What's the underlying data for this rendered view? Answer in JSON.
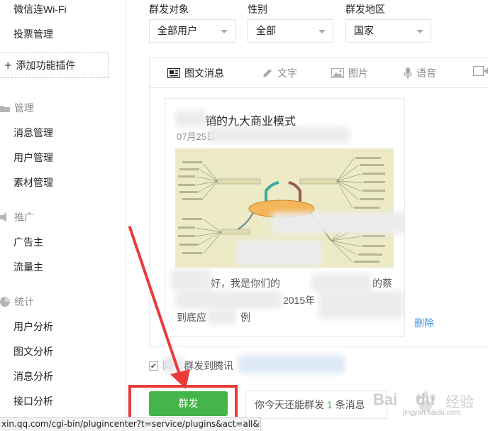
{
  "sidebar": {
    "items_top": [
      {
        "label": "微信连Wi-Fi"
      },
      {
        "label": "投票管理"
      }
    ],
    "add_plugin_label": "添加功能插件",
    "sections": [
      {
        "title": "管理",
        "items": [
          "消息管理",
          "用户管理",
          "素材管理"
        ]
      },
      {
        "title": "推广",
        "items": [
          "广告主",
          "流量主"
        ]
      },
      {
        "title": "统计",
        "items": [
          "用户分析",
          "图文分析",
          "消息分析",
          "接口分析"
        ]
      }
    ]
  },
  "filters": {
    "target": {
      "label": "群发对象",
      "value": "全部用户"
    },
    "gender": {
      "label": "性别",
      "value": "全部"
    },
    "region": {
      "label": "群发地区",
      "value": "国家"
    }
  },
  "tabs": [
    "图文消息",
    "文字",
    "图片",
    "语音"
  ],
  "article": {
    "title": "销的九大商业模式",
    "date": "07月25日",
    "excerpt_line1": "好，我是你们的",
    "excerpt_line1b": "的蔡",
    "excerpt_line2": "2015年",
    "excerpt_line3": "到底应",
    "excerpt_line3b": "例"
  },
  "delete_label": "删除",
  "sync": {
    "prefix": "同",
    "label": "群发到腾讯",
    "suffix": "",
    "checked_glyph": "✔"
  },
  "send_button": "群发",
  "quota": {
    "prefix": "你今天还能群发",
    "count": "1",
    "suffix": "条消息"
  },
  "statusbar_url": "xin.qq.com/cgi-bin/plugincenter?t=service/plugins&act=all&t...",
  "watermark": {
    "brand": "Bai",
    "brand2": "du",
    "product": "经验",
    "domain": "jingyan.baidu.com"
  },
  "colors": {
    "accent_green": "#44b549",
    "link_blue": "#459ae9",
    "annotation_red": "#ea3b3b"
  }
}
